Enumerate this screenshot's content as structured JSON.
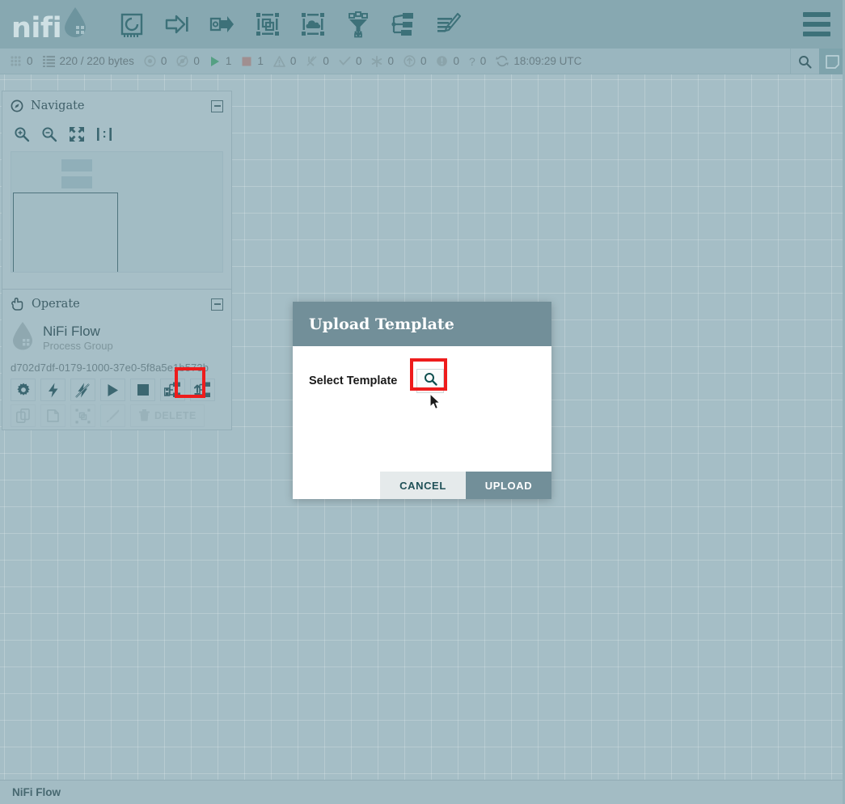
{
  "app": {
    "logo_text": "nifi",
    "logo_icon": "water-drop-icon"
  },
  "header": {
    "toolbar_icons": [
      {
        "name": "processor-icon",
        "title": "Processor"
      },
      {
        "name": "input-port-icon",
        "title": "Input Port"
      },
      {
        "name": "output-port-icon",
        "title": "Output Port"
      },
      {
        "name": "process-group-icon",
        "title": "Process Group"
      },
      {
        "name": "remote-process-group-icon",
        "title": "Remote Process Group"
      },
      {
        "name": "funnel-icon",
        "title": "Funnel"
      },
      {
        "name": "template-icon",
        "title": "Template"
      },
      {
        "name": "label-icon",
        "title": "Label"
      }
    ],
    "menu_icon": "hamburger-menu-icon"
  },
  "statusbar": {
    "items": [
      {
        "icon": "active-threads-icon",
        "value": "0"
      },
      {
        "icon": "queued-flowfiles-icon",
        "value": "220 / 220 bytes"
      },
      {
        "icon": "transmitting-ports-icon",
        "value": "0"
      },
      {
        "icon": "not-transmitting-ports-icon",
        "value": "0"
      },
      {
        "icon": "running-components-icon",
        "value": "1"
      },
      {
        "icon": "stopped-components-icon",
        "value": "1"
      },
      {
        "icon": "invalid-components-icon",
        "value": "0"
      },
      {
        "icon": "disabled-components-icon",
        "value": "0"
      },
      {
        "icon": "up-to-date-icon",
        "value": "0"
      },
      {
        "icon": "locally-modified-icon",
        "value": "0"
      },
      {
        "icon": "stale-icon",
        "value": "0"
      },
      {
        "icon": "locally-modified-and-stale-icon",
        "value": "0"
      },
      {
        "icon": "sync-failure-icon",
        "value": "0"
      },
      {
        "icon": "refresh-icon",
        "value": "18:09:29 UTC"
      }
    ],
    "search_icon": "search-icon",
    "panel_toggle_icon": "panel-toggle-icon"
  },
  "navigate": {
    "title": "Navigate",
    "header_icon": "compass-icon",
    "collapse_icon": "collapse-icon",
    "tools": [
      {
        "name": "zoom-in-button",
        "icon": "zoom-in-icon"
      },
      {
        "name": "zoom-out-button",
        "icon": "zoom-out-icon"
      },
      {
        "name": "fit-to-screen-button",
        "icon": "fit-screen-icon"
      },
      {
        "name": "actual-size-button",
        "icon": "actual-size-icon"
      }
    ]
  },
  "operate": {
    "title": "Operate",
    "header_icon": "hand-icon",
    "collapse_icon": "collapse-icon",
    "process_group_name": "NiFi Flow",
    "process_group_type": "Process Group",
    "process_group_id": "d702d7df-0179-1000-37e0-5f8a5e1b573b",
    "buttons_row1": [
      {
        "name": "configure-button",
        "icon": "gear-icon",
        "enabled": true
      },
      {
        "name": "enable-button",
        "icon": "lightning-icon",
        "enabled": true
      },
      {
        "name": "disable-button",
        "icon": "lightning-off-icon",
        "enabled": true
      },
      {
        "name": "start-button",
        "icon": "play-icon",
        "enabled": true
      },
      {
        "name": "stop-button",
        "icon": "stop-icon",
        "enabled": true
      },
      {
        "name": "create-template-button",
        "icon": "save-template-icon",
        "enabled": true
      },
      {
        "name": "upload-template-button",
        "icon": "upload-template-icon",
        "enabled": true,
        "highlighted": true
      }
    ],
    "buttons_row2": [
      {
        "name": "copy-button",
        "icon": "copy-icon",
        "enabled": false
      },
      {
        "name": "paste-button",
        "icon": "paste-icon",
        "enabled": false
      },
      {
        "name": "group-button",
        "icon": "group-icon",
        "enabled": false
      },
      {
        "name": "change-color-button",
        "icon": "paintbrush-icon",
        "enabled": false
      },
      {
        "name": "delete-button",
        "icon": "trash-icon",
        "label": "DELETE",
        "enabled": false
      }
    ]
  },
  "dialog": {
    "title": "Upload Template",
    "field_label": "Select Template",
    "browse_icon": "search-icon",
    "cancel_label": "CANCEL",
    "upload_label": "UPLOAD"
  },
  "bottombar": {
    "breadcrumb": "NiFi Flow"
  },
  "colors": {
    "header_bg": "#87a8b1",
    "statusbar_bg": "#9ab6bf",
    "canvas_bg": "#a5bec6",
    "panel_bg": "#a7bfc7",
    "dialog_header_bg": "#728f99",
    "dialog_body_bg": "#ffffff",
    "upload_button_bg": "#728f99",
    "cancel_button_bg": "#e5eaeb",
    "highlight_red": "#ee1c1c",
    "icon_teal": "#3d7179",
    "running_green": "#4c9d7e",
    "stopped_gray": "#9d8b8b"
  }
}
